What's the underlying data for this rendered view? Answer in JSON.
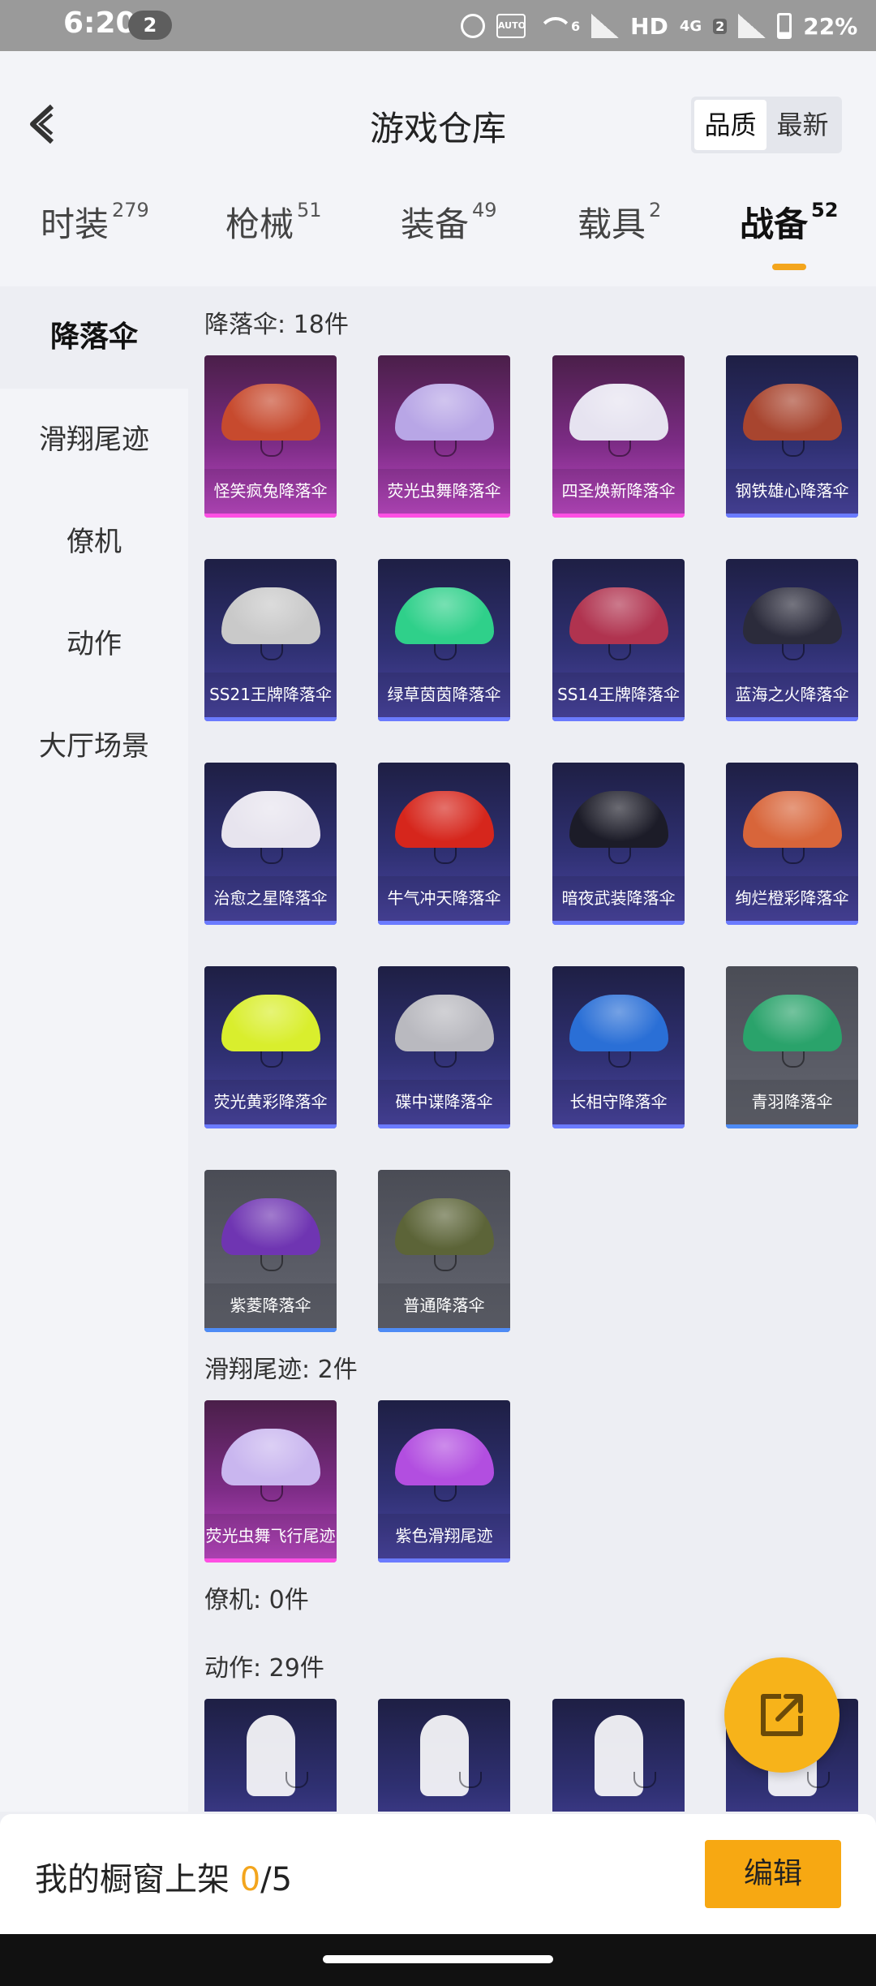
{
  "status_bar": {
    "time": "6:20",
    "notification_count": "2",
    "network": "HD",
    "net_type": "4G",
    "sim_badge": "2",
    "wifi_badge": "6",
    "battery": "22%"
  },
  "header": {
    "title": "游戏仓库",
    "sort_options": [
      "品质",
      "最新"
    ],
    "sort_selected": "品质"
  },
  "tabs": [
    {
      "label": "时装",
      "count": "279"
    },
    {
      "label": "枪械",
      "count": "51"
    },
    {
      "label": "装备",
      "count": "49"
    },
    {
      "label": "载具",
      "count": "2"
    },
    {
      "label": "战备",
      "count": "52"
    }
  ],
  "sidebar": {
    "items": [
      "降落伞",
      "滑翔尾迹",
      "僚机",
      "动作",
      "大厅场景"
    ],
    "selected": "降落伞"
  },
  "sections": {
    "parachute": {
      "title": "降落伞: 18件",
      "items": [
        {
          "name": "怪笑疯兔降落伞",
          "rarity": "pink",
          "color": "#c74a2e"
        },
        {
          "name": "荧光虫舞降落伞",
          "rarity": "pink",
          "color": "#b8a6e6"
        },
        {
          "name": "四圣焕新降落伞",
          "rarity": "pink",
          "color": "#e6e3f0"
        },
        {
          "name": "钢铁雄心降落伞",
          "rarity": "blue",
          "color": "#a8452f"
        },
        {
          "name": "SS21王牌降落伞",
          "rarity": "blue",
          "color": "#c9c9c9"
        },
        {
          "name": "绿草茵茵降落伞",
          "rarity": "blue",
          "color": "#2fd08a"
        },
        {
          "name": "SS14王牌降落伞",
          "rarity": "blue",
          "color": "#b0334f"
        },
        {
          "name": "蓝海之火降落伞",
          "rarity": "blue",
          "color": "#2b2b3b"
        },
        {
          "name": "治愈之星降落伞",
          "rarity": "blue",
          "color": "#e7e4ee"
        },
        {
          "name": "牛气冲天降落伞",
          "rarity": "blue",
          "color": "#d6261c"
        },
        {
          "name": "暗夜武装降落伞",
          "rarity": "blue",
          "color": "#1c1c28"
        },
        {
          "name": "绚烂橙彩降落伞",
          "rarity": "blue",
          "color": "#d8653a"
        },
        {
          "name": "荧光黄彩降落伞",
          "rarity": "blue",
          "color": "#d9ee2d"
        },
        {
          "name": "碟中谍降落伞",
          "rarity": "blue",
          "color": "#b9b9bf"
        },
        {
          "name": "长相守降落伞",
          "rarity": "blue",
          "color": "#2a6fd6"
        },
        {
          "name": "青羽降落伞",
          "rarity": "gray",
          "color": "#2aa36b"
        },
        {
          "name": "紫菱降落伞",
          "rarity": "gray",
          "color": "#6f35b2"
        },
        {
          "name": "普通降落伞",
          "rarity": "gray",
          "color": "#5c6438"
        }
      ]
    },
    "trail": {
      "title": "滑翔尾迹: 2件",
      "items": [
        {
          "name": "荧光虫舞飞行尾迹",
          "rarity": "pink",
          "color": "#c9b6ef"
        },
        {
          "name": "紫色滑翔尾迹",
          "rarity": "blue",
          "color": "#b24ee0"
        }
      ]
    },
    "wingman": {
      "title": "僚机: 0件"
    },
    "emote": {
      "title": "动作: 29件",
      "items": [
        {
          "name": "",
          "rarity": "blue",
          "color": "#ffffff"
        },
        {
          "name": "",
          "rarity": "blue",
          "color": "#ffffff"
        },
        {
          "name": "",
          "rarity": "blue",
          "color": "#ffffff"
        },
        {
          "name": "",
          "rarity": "blue",
          "color": "#ffffff"
        }
      ]
    }
  },
  "bottom_bar": {
    "label": "我的橱窗上架 ",
    "current": "0",
    "total": "/5",
    "edit_label": "编辑"
  },
  "colors": {
    "accent": "#f3a51d",
    "pink_rarity": "#ff4fe3",
    "blue_rarity": "#6b7bff",
    "gray_rarity": "#4e8bf5"
  }
}
